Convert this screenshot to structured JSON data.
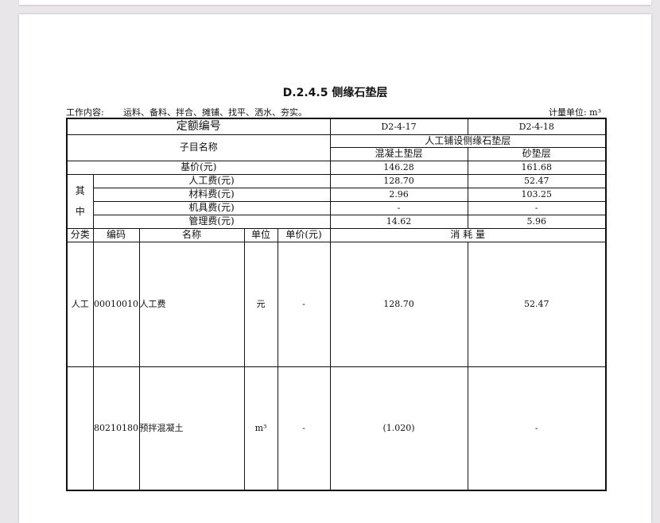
{
  "title": "D.2.4.5 侧缘石垫层",
  "work_label": "工作内容:",
  "work_content": "运料、备料、拌合、摊铺、找平、洒水、夯实。",
  "unit_label": "计量单位: m³",
  "header": {
    "quota_no_label": "定额编号",
    "item_name_label": "子目名称",
    "base_price_label": "基价(元)",
    "among_label_1": "其",
    "among_label_2": "中",
    "labor_label": "人工费(元)",
    "material_label": "材料费(元)",
    "machine_label": "机具费(元)",
    "mgmt_label": "管理费(元)",
    "group_name": "人工铺设侧缘石垫层"
  },
  "columns": [
    {
      "code": "D2-4-17",
      "name": "混凝土垫层",
      "base_price": "146.28",
      "labor": "128.70",
      "material": "2.96",
      "machine": "-",
      "mgmt": "14.62"
    },
    {
      "code": "D2-4-18",
      "name": "砂垫层",
      "base_price": "161.68",
      "labor": "52.47",
      "material": "103.25",
      "machine": "-",
      "mgmt": "5.96"
    }
  ],
  "detail_header": {
    "category": "分类",
    "code": "编码",
    "name": "名称",
    "unit": "单位",
    "unit_price": "单价(元)",
    "consumption": "消 耗 量"
  },
  "rows": [
    {
      "category": "人工",
      "code": "00010010",
      "name": "人工费",
      "unit": "元",
      "unit_price": "-",
      "v1": "128.70",
      "v2": "52.47"
    },
    {
      "category": "",
      "code": "80210180",
      "name": "预拌混凝土",
      "unit": "m³",
      "unit_price": "-",
      "v1": "(1.020)",
      "v2": "-"
    }
  ]
}
